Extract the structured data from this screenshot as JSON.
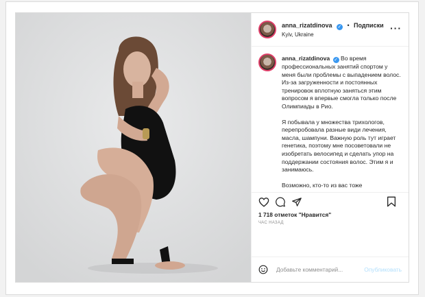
{
  "post": {
    "username": "anna_rizatdinova",
    "location": "Kyiv, Ukraine",
    "follow_label": "Подписки",
    "more_label": "···",
    "verified_mark": "✓",
    "caption": {
      "username": "anna_rizatdinova",
      "paragraphs": [
        "Во время профессиональных занятий спортом у меня были проблемы с выпадением волос. Из-за загруженности и постоянных тренировок вплотную заняться этим вопросом я впервые смогла только после Олимпиады в Рио.",
        "Я побывала у множества трихологов, перепробовала разные види лечения, масла, шампуни. Важную роль тут играет генетика, поэтому мне посоветовали не изобретать велосипед и сделать упор на поддержании состояния волос. Этим я и занимаюсь.",
        "Возможно, кто-то из вас тоже"
      ]
    },
    "likes": "1 718 отметок \"Нравится\"",
    "time": "ЧАС НАЗАД",
    "comment_placeholder": "Добавьте комментарий...",
    "publish_label": "Опубликовать",
    "icons": [
      "heart-icon",
      "comment-icon",
      "share-icon",
      "bookmark-icon",
      "emoji-icon"
    ],
    "colors": {
      "verified": "#3897f0",
      "publish": "#b2dffc",
      "border": "#dbdbdb"
    }
  }
}
